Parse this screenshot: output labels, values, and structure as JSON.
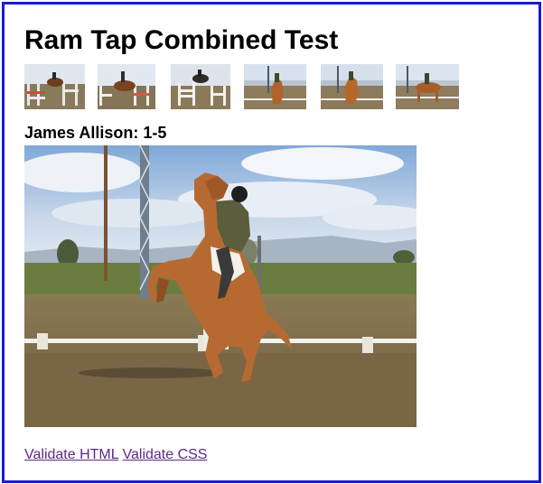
{
  "page": {
    "title": "Ram Tap Combined Test",
    "caption": "James Allison: 1-5",
    "frame_color": "#1a1ad6",
    "link_color": "#5b2a86"
  },
  "thumbnails": [
    {
      "name": "thumbnail-1",
      "scene": "show-jumping"
    },
    {
      "name": "thumbnail-2",
      "scene": "show-jumping"
    },
    {
      "name": "thumbnail-3",
      "scene": "show-jumping"
    },
    {
      "name": "thumbnail-4",
      "scene": "dressage-rearing"
    },
    {
      "name": "thumbnail-5",
      "scene": "dressage-rearing"
    },
    {
      "name": "thumbnail-6",
      "scene": "dressage"
    }
  ],
  "footer": {
    "validate_html": "Validate HTML",
    "validate_css": "Validate CSS"
  }
}
